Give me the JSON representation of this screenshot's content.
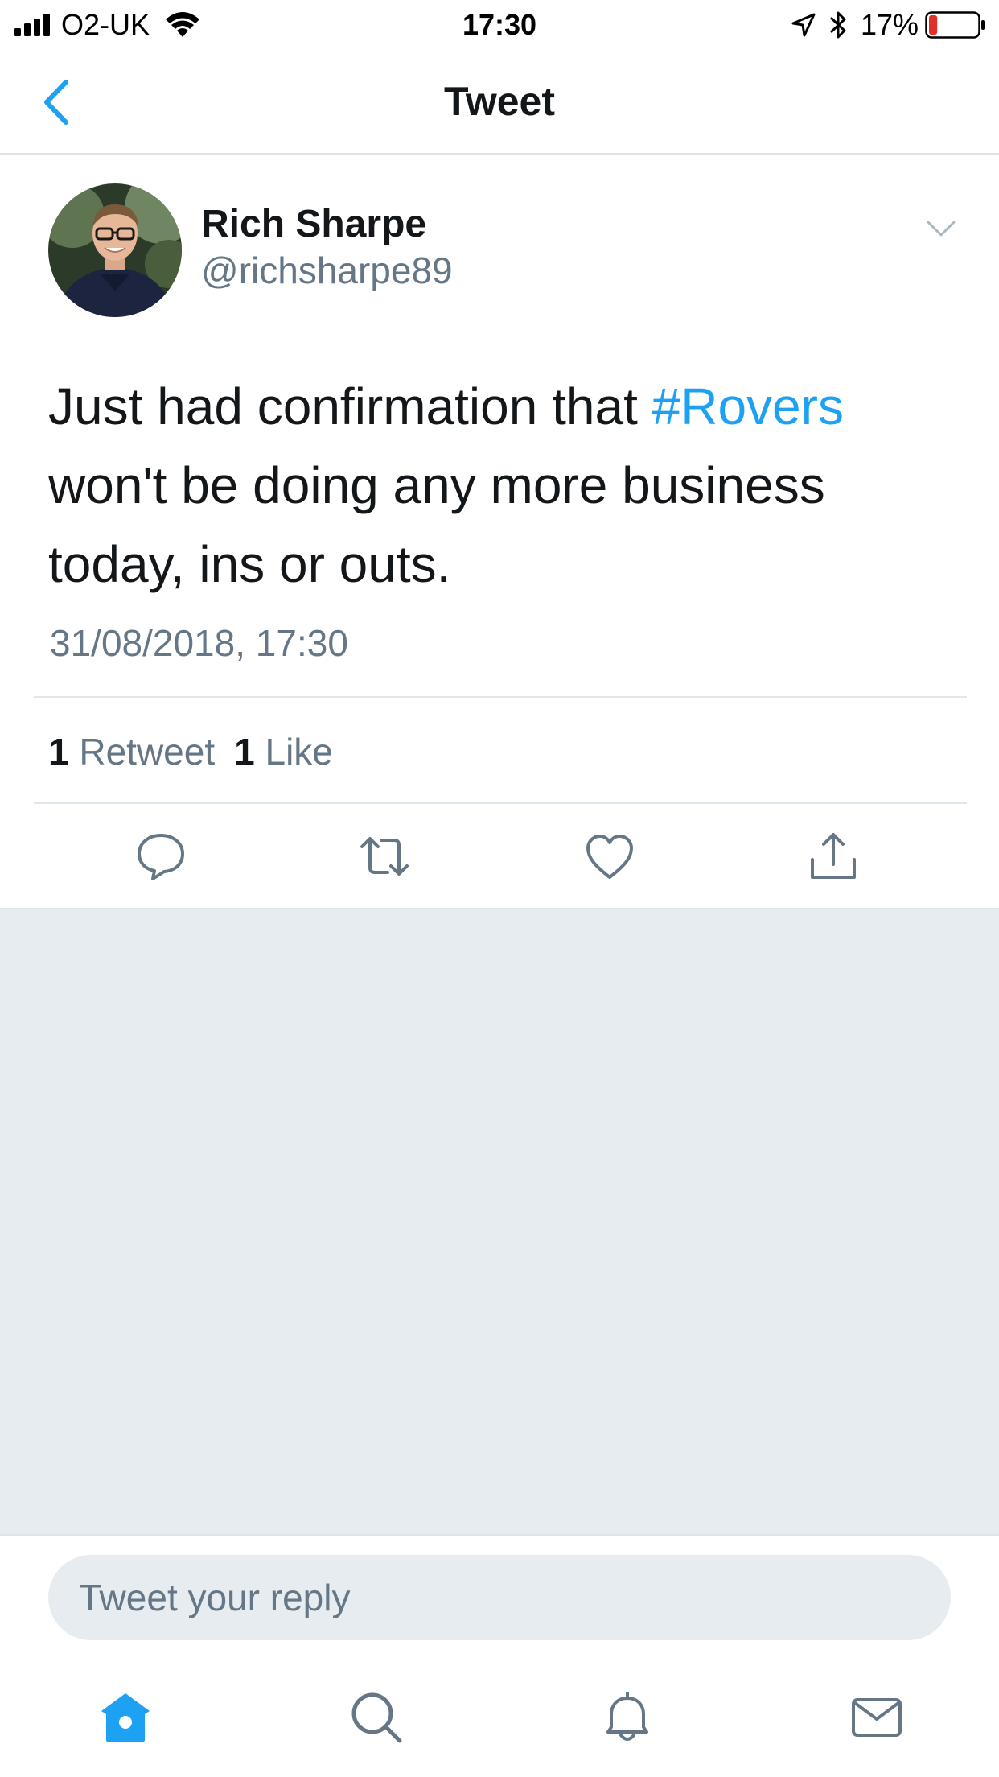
{
  "status_bar": {
    "carrier": "O2-UK",
    "time": "17:30",
    "battery_percent": "17%",
    "battery_level": 0.17,
    "battery_color": "#e0302a"
  },
  "nav": {
    "title": "Tweet",
    "back_icon": "chevron-left-icon",
    "accent_color": "#1da1f2"
  },
  "tweet": {
    "author_name": "Rich Sharpe",
    "author_handle": "@richsharpe89",
    "text_before": "Just had confirmation that ",
    "hashtag": "#Rovers",
    "text_after": " won't be doing any more business today, ins or outs.",
    "timestamp": "31/08/2018, 17:30",
    "retweet_count": "1",
    "retweet_label": "Retweet",
    "like_count": "1",
    "like_label": "Like"
  },
  "actions": [
    "reply-icon",
    "retweet-icon",
    "like-icon",
    "share-icon"
  ],
  "reply": {
    "placeholder": "Tweet your reply"
  },
  "tab_bar": {
    "items": [
      "home-icon",
      "search-icon",
      "notifications-icon",
      "messages-icon"
    ],
    "active": "home-icon"
  }
}
